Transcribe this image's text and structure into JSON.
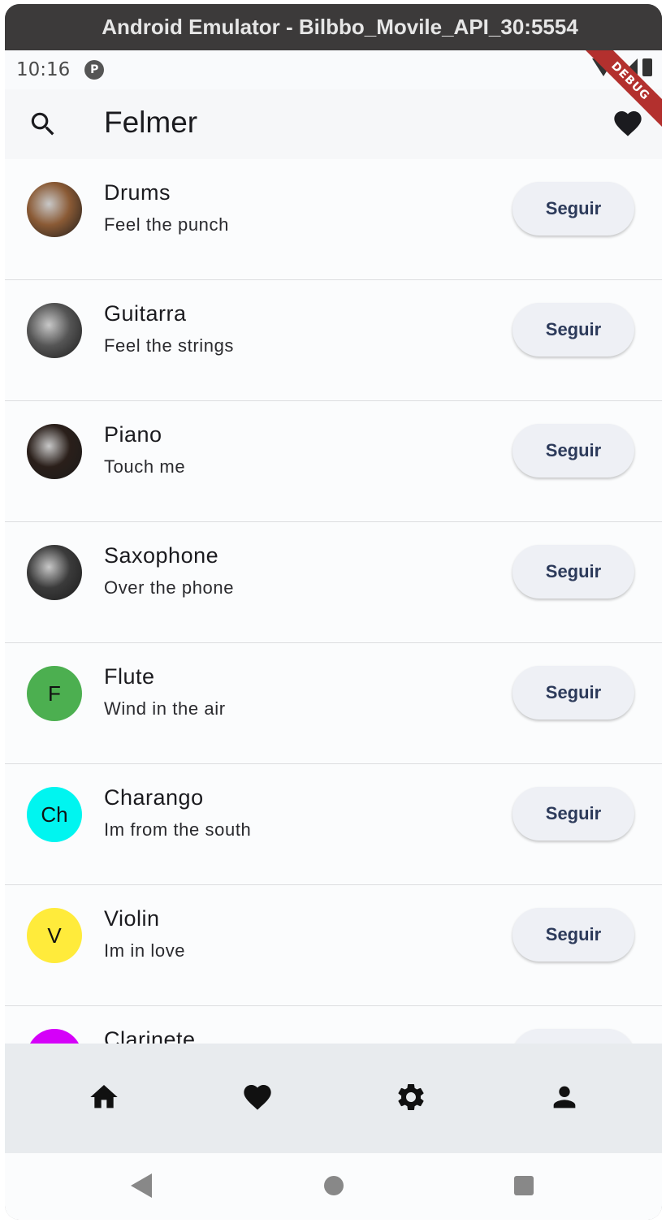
{
  "window": {
    "title": "Android Emulator - Bilbbo_Movile_API_30:5554"
  },
  "statusbar": {
    "time": "10:16",
    "debug_label": "DEBUG"
  },
  "appbar": {
    "title": "Felmer"
  },
  "items": [
    {
      "title": "Drums",
      "subtitle": "Feel the punch",
      "avatar_type": "photo",
      "avatar_text": "",
      "avatar_color": "#8a5a35",
      "button": "Seguir"
    },
    {
      "title": "Guitarra",
      "subtitle": "Feel the strings",
      "avatar_type": "photo",
      "avatar_text": "",
      "avatar_color": "#555555",
      "button": "Seguir"
    },
    {
      "title": "Piano",
      "subtitle": "Touch me",
      "avatar_type": "photo",
      "avatar_text": "",
      "avatar_color": "#2a1f1a",
      "button": "Seguir"
    },
    {
      "title": "Saxophone",
      "subtitle": "Over the phone",
      "avatar_type": "photo",
      "avatar_text": "",
      "avatar_color": "#3b3b3b",
      "button": "Seguir"
    },
    {
      "title": "Flute",
      "subtitle": "Wind in the air",
      "avatar_type": "letter",
      "avatar_text": "F",
      "avatar_color": "#4caf50",
      "button": "Seguir"
    },
    {
      "title": "Charango",
      "subtitle": "Im from the south",
      "avatar_type": "letter",
      "avatar_text": "Ch",
      "avatar_color": "#00f5f0",
      "button": "Seguir"
    },
    {
      "title": "Violin",
      "subtitle": "Im in love",
      "avatar_type": "letter",
      "avatar_text": "V",
      "avatar_color": "#ffeb3b",
      "button": "Seguir"
    },
    {
      "title": "Clarinete",
      "subtitle": "",
      "avatar_type": "letter",
      "avatar_text": "",
      "avatar_color": "#d500f9",
      "button": ""
    }
  ],
  "bottom_nav": [
    {
      "icon": "home-icon"
    },
    {
      "icon": "heart-icon"
    },
    {
      "icon": "gear-icon"
    },
    {
      "icon": "person-icon"
    }
  ]
}
